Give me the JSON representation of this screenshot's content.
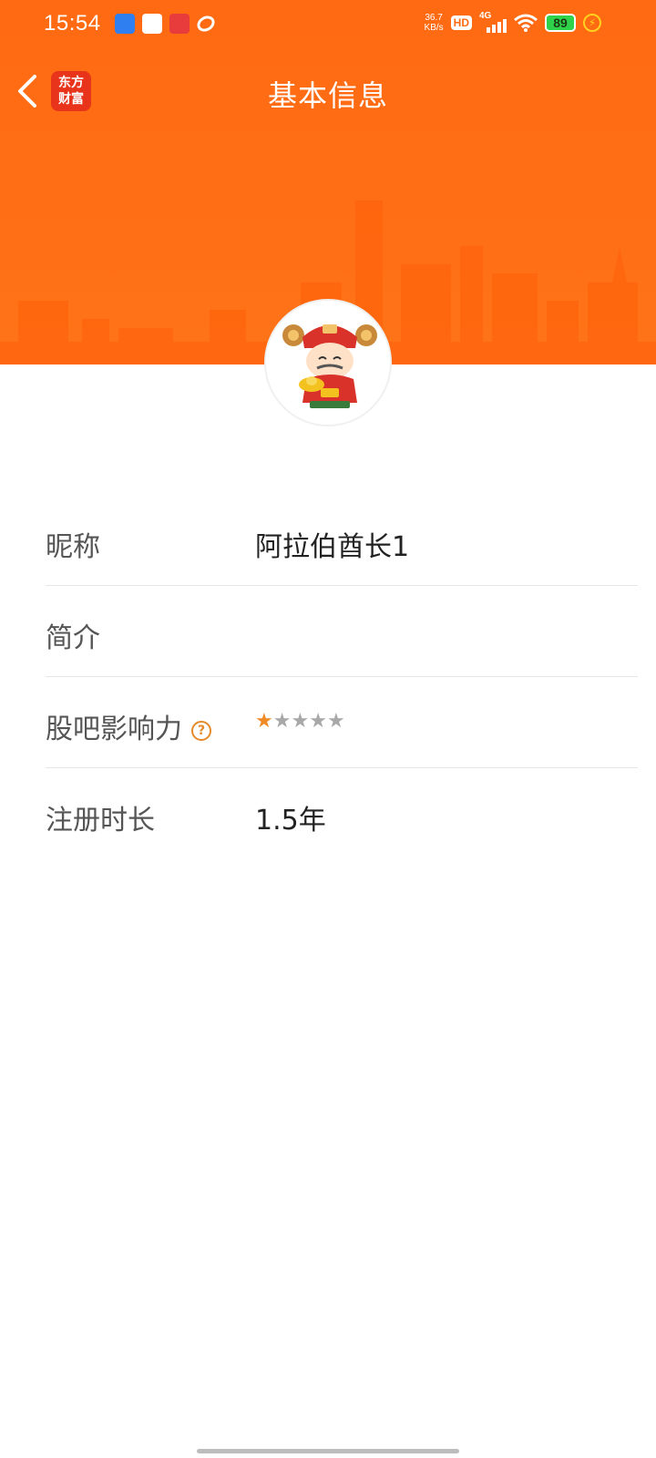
{
  "status_bar": {
    "time": "15:54",
    "net_speed_value": "36.7",
    "net_speed_unit": "KB/s",
    "hd": "HD",
    "cellular": "4G",
    "battery": "89"
  },
  "nav": {
    "title": "基本信息",
    "app_logo_line1": "东方",
    "app_logo_line2": "财富"
  },
  "profile": {
    "rows": [
      {
        "label": "昵称",
        "value": "阿拉伯酋长1"
      },
      {
        "label": "简介",
        "value": ""
      },
      {
        "label": "股吧影响力",
        "value": ""
      },
      {
        "label": "注册时长",
        "value": "1.5年"
      }
    ],
    "influence_stars": {
      "filled": 1,
      "total": 5
    }
  },
  "colors": {
    "brand_orange": "#ff6a12",
    "star_on": "#f08a24",
    "star_off": "#a8a8a8",
    "help_icon": "#e58a2a"
  }
}
